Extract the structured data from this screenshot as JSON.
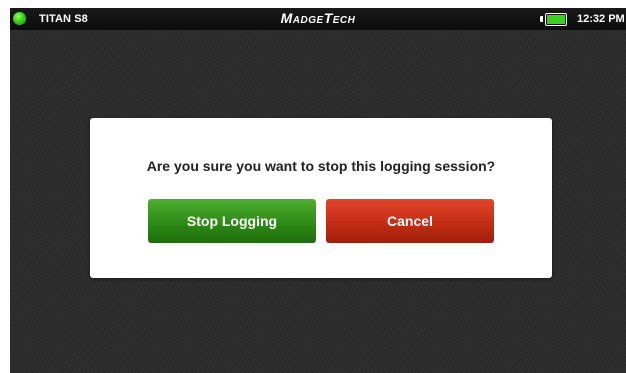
{
  "status_bar": {
    "device_name": "TITAN S8",
    "brand": "MadgeTech",
    "time": "12:32 PM",
    "battery_level": 1.0,
    "status_color": "#39d11a"
  },
  "dialog": {
    "message": "Are you sure you want to stop this logging session?",
    "stop_label": "Stop Logging",
    "cancel_label": "Cancel",
    "stop_color": "#2e8a16",
    "cancel_color": "#c32d14"
  },
  "icons": {
    "status": "status-indicator-icon",
    "battery": "battery-icon"
  }
}
